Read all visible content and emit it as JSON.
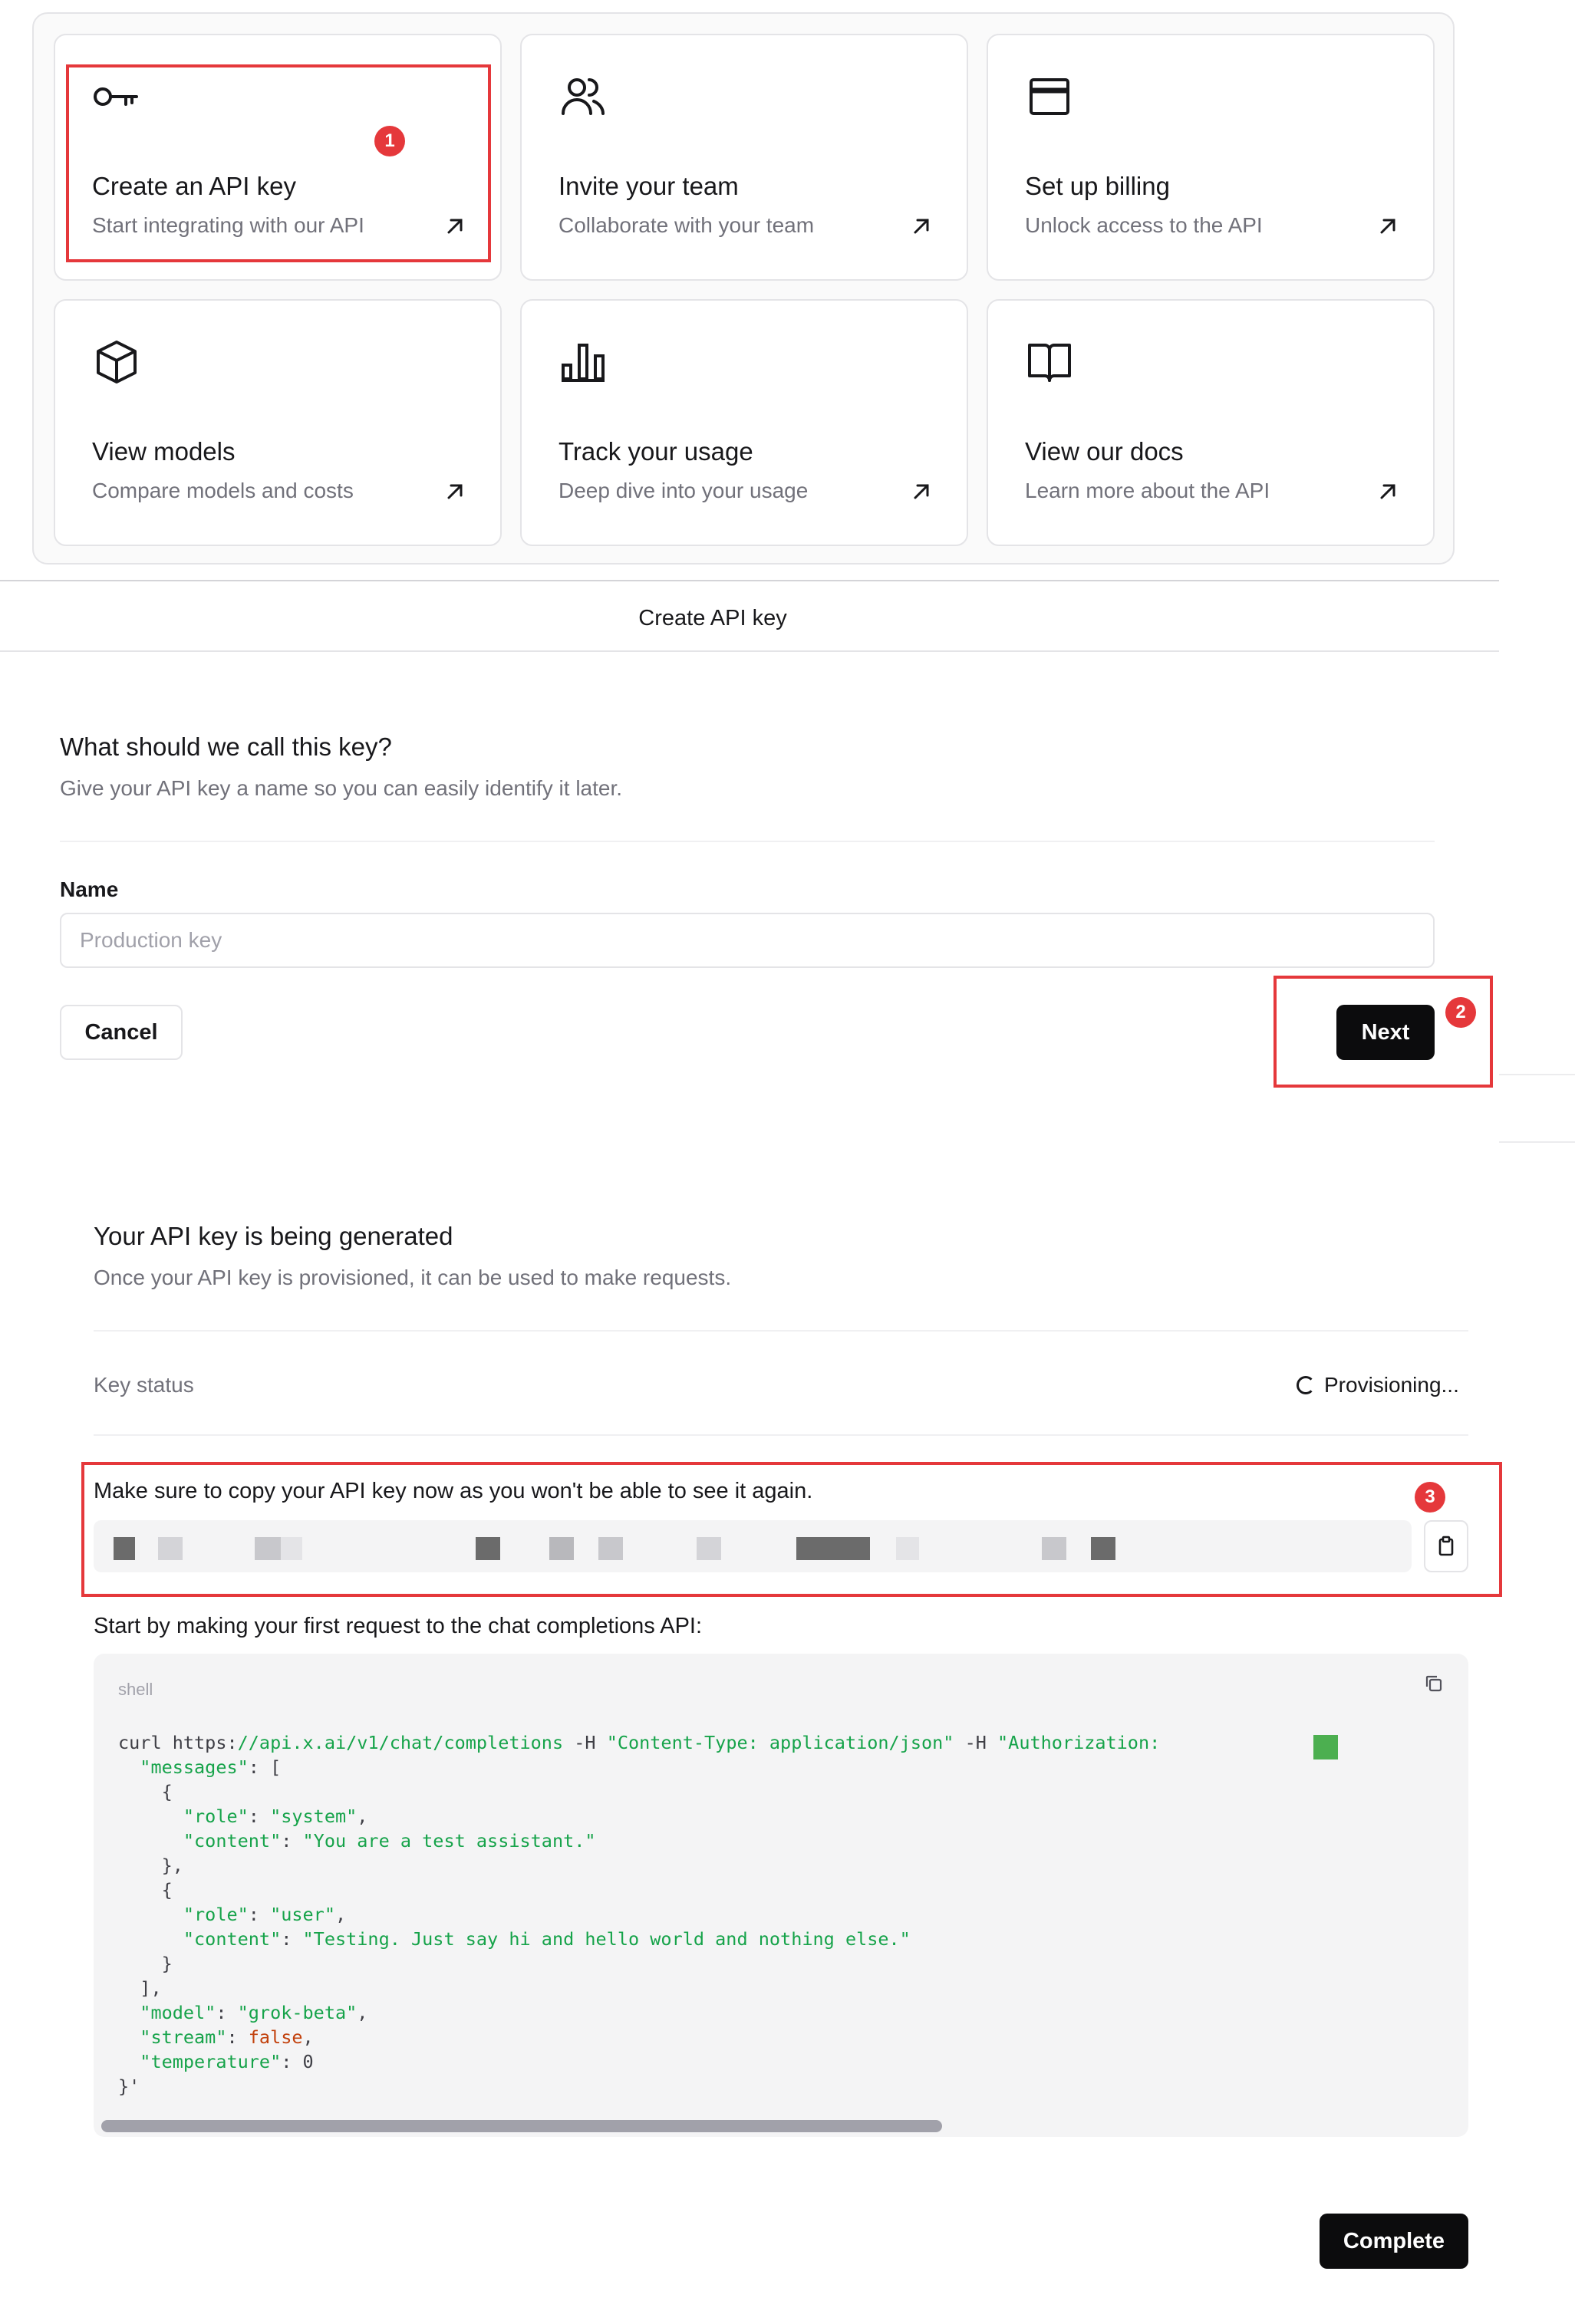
{
  "cards": [
    {
      "icon": "key-icon",
      "title": "Create an API key",
      "desc": "Start integrating with our API"
    },
    {
      "icon": "team-icon",
      "title": "Invite your team",
      "desc": "Collaborate with your team"
    },
    {
      "icon": "credit-card-icon",
      "title": "Set up billing",
      "desc": "Unlock access to the API"
    },
    {
      "icon": "cube-icon",
      "title": "View models",
      "desc": "Compare models and costs"
    },
    {
      "icon": "bar-chart-icon",
      "title": "Track your usage",
      "desc": "Deep dive into your usage"
    },
    {
      "icon": "book-icon",
      "title": "View our docs",
      "desc": "Learn more about the API"
    }
  ],
  "annotations": {
    "step1": "1",
    "step2": "2",
    "step3": "3",
    "color": "#e5383b"
  },
  "dialog": {
    "title": "Create API key"
  },
  "name_step": {
    "heading": "What should we call this key?",
    "subtitle": "Give your API key a name so you can easily identify it later.",
    "field_label": "Name",
    "placeholder": "Production key",
    "value": "",
    "cancel_label": "Cancel",
    "next_label": "Next"
  },
  "generated_step": {
    "heading": "Your API key is being generated",
    "subtitle": "Once your API key is provisioned, it can be used to make requests.",
    "status_label": "Key status",
    "status_value": "Provisioning...",
    "copy_note": "Make sure to copy your API key now as you won't be able to see it again.",
    "first_request": "Start by making your first request to the chat completions API:",
    "code_language": "shell",
    "complete_label": "Complete"
  },
  "code_lines": [
    [
      [
        "t",
        "curl https:"
      ],
      [
        "s",
        "//api.x.ai/v1/chat/completions"
      ],
      [
        "t",
        " -H "
      ],
      [
        "s",
        "\"Content-Type: application/json\""
      ],
      [
        "t",
        " -H "
      ],
      [
        "s",
        "\"Authorization:"
      ]
    ],
    [
      [
        "t",
        "  "
      ],
      [
        "s",
        "\"messages\""
      ],
      [
        "t",
        ": ["
      ]
    ],
    [
      [
        "t",
        "    {"
      ]
    ],
    [
      [
        "t",
        "      "
      ],
      [
        "s",
        "\"role\""
      ],
      [
        "t",
        ": "
      ],
      [
        "s",
        "\"system\""
      ],
      [
        "t",
        ","
      ]
    ],
    [
      [
        "t",
        "      "
      ],
      [
        "s",
        "\"content\""
      ],
      [
        "t",
        ": "
      ],
      [
        "s",
        "\"You are a test assistant.\""
      ]
    ],
    [
      [
        "t",
        "    },"
      ]
    ],
    [
      [
        "t",
        "    {"
      ]
    ],
    [
      [
        "t",
        "      "
      ],
      [
        "s",
        "\"role\""
      ],
      [
        "t",
        ": "
      ],
      [
        "s",
        "\"user\""
      ],
      [
        "t",
        ","
      ]
    ],
    [
      [
        "t",
        "      "
      ],
      [
        "s",
        "\"content\""
      ],
      [
        "t",
        ": "
      ],
      [
        "s",
        "\"Testing. Just say hi and hello world and nothing else.\""
      ]
    ],
    [
      [
        "t",
        "    }"
      ]
    ],
    [
      [
        "t",
        "  ],"
      ]
    ],
    [
      [
        "t",
        "  "
      ],
      [
        "s",
        "\"model\""
      ],
      [
        "t",
        ": "
      ],
      [
        "s",
        "\"grok-beta\""
      ],
      [
        "t",
        ","
      ]
    ],
    [
      [
        "t",
        "  "
      ],
      [
        "s",
        "\"stream\""
      ],
      [
        "t",
        ": "
      ],
      [
        "k",
        "false"
      ],
      [
        "t",
        ","
      ]
    ],
    [
      [
        "t",
        "  "
      ],
      [
        "s",
        "\"temperature\""
      ],
      [
        "t",
        ": 0"
      ]
    ],
    [
      [
        "t",
        "}'"
      ]
    ]
  ],
  "colors": {
    "accent_dark": "#0c0c0d",
    "code_string": "#16a34a",
    "code_keyword": "#c2410c",
    "annotation": "#e5383b"
  }
}
